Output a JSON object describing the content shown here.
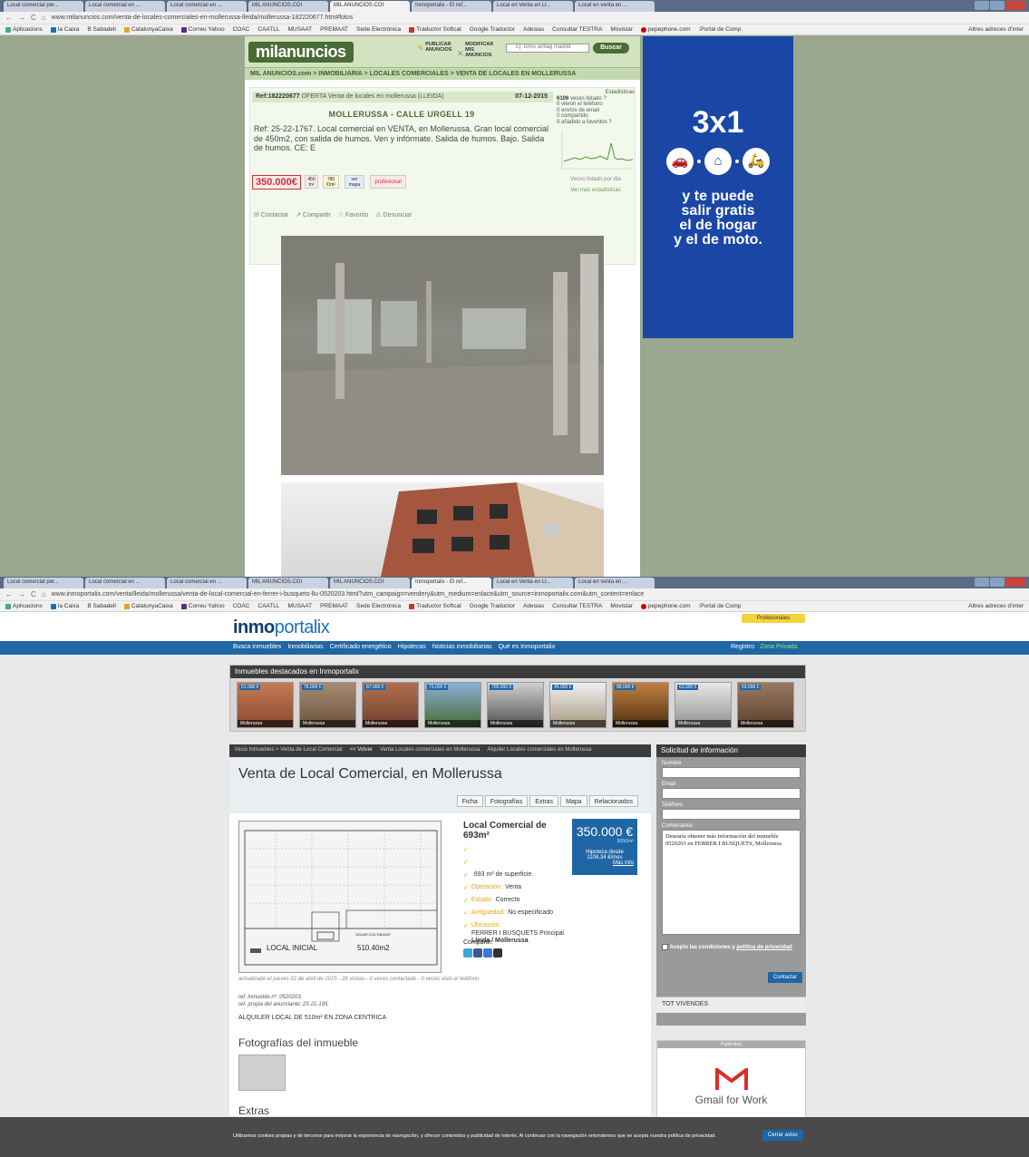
{
  "colors": {
    "mil_green": "#4b6b35",
    "mil_price_red": "#c33",
    "banner_blue": "#1a47a6",
    "inmo_blue": "#1f66a5",
    "inmo_tick": "#e5a61a"
  },
  "shot1": {
    "tabs": [
      "Local comercial per...",
      "Local comercial en ...",
      "Local comercial en ...",
      "MIL ANUNCIOS.COI",
      "MIL ANUNCIOS.COI",
      "Inmoportalix - El ref...",
      "Local en Venta en LI...",
      "Local en venta en ..."
    ],
    "url": "www.milanuncios.com/venta-de-locales-comerciales-en-mollerussa-lleida/mollerussa-182220677.htm#fotos",
    "bookmarks": [
      "Aplicacions",
      "la Caixa",
      "B Sabadell",
      "CatalunyaCaixa",
      "Correu Yahoo",
      "COAC",
      "CAATLL",
      "MUSAAT",
      "PREMAAT",
      "Sede Electrónica",
      "Traductor Softcat",
      "Google Traductor",
      "Adesias",
      "Consultar TESTRA",
      "Movistar",
      "pepephone.com",
      ":Portal de Comp"
    ],
    "bookmarks_other": "Altres adreces d'inter"
  },
  "mil": {
    "logo": "milanuncios",
    "publicar": "PUBLICAR ANUNCIOS",
    "modificar": "MODIFICAR MIS ANUNCIOS",
    "search_placeholder": "Ej: tomo airbag madrid",
    "search_button": "Buscar",
    "breadcrumb": "MIL ANUNCIOS.com > INMOBILIARIA > LOCALES COMERCIALES > VENTA DE LOCALES EN MOLLERUSSA",
    "ref": "Ref:182220677",
    "ref_tail": "OFERTA   Venta de locales en mollerussa (LLEIDA)",
    "date": "07-12-2015",
    "title": "MOLLERUSSA - CALLE URGELL 19",
    "description": "Ref: 25-22-1767. Local comercial en VENTA, en Mollerussa. Gran local comercial de 450m2, con salida de humos. Ven y infórmate. Salida de humos. Bajo. Salida de humos. CE: E",
    "price": "350.000€",
    "tag1": "450 m²",
    "tag2": "780 €/m²",
    "tag3": "ver mapa",
    "tag_prof": "profesional",
    "actions": [
      "Contactar",
      "Compartir",
      "Favorito",
      "Denunciar"
    ],
    "stats": {
      "heading": "Estadísticas",
      "views": "6106",
      "views_label": "veces listado ?",
      "lines": [
        "0 vieron el teléfono",
        "0 envíos de email",
        "0 compartido",
        "0 añadido a favoritos ?"
      ],
      "chart_label": "Veces listado por día",
      "more": "Ver más estadísticas"
    }
  },
  "banner": {
    "big": "3x1",
    "line1": "y te puede",
    "line2": "salir gratis",
    "line3": "el de hogar",
    "line4": "y el de moto."
  },
  "shot2": {
    "url": "www.inmoportalix.com/venta/lleida/mollerussa/venta-de-local-comercial-en-ferrer-i-busquets-llu-0520203.html?utm_campaign=vendery&utm_medium=enlace&utm_source=inmoportalix.com&utm_content=enlace"
  },
  "inmo": {
    "logo_a": "inmo",
    "logo_b": "portalix",
    "profesionales": "Profesionales",
    "nav": [
      "Busca inmuebles",
      "Inmobiliarias",
      "Certificado energético",
      "Hipotecas",
      "Noticias inmobiliarias",
      "Qué es Inmoportalix"
    ],
    "registro": "Registro",
    "zona_privada": "Zona Privada",
    "featured_title": "Inmuebles destacados en Inmoportalix",
    "featured": [
      {
        "price": "51.000 €",
        "loc": "Mollerussa"
      },
      {
        "price": "76.000 €",
        "loc": "Mollerussa"
      },
      {
        "price": "87.000 €",
        "loc": "Mollerussa"
      },
      {
        "price": "73.000 €",
        "loc": "Mollerussa"
      },
      {
        "price": "700.000 €",
        "loc": "Mollerussa"
      },
      {
        "price": "45.000 €",
        "loc": "Mollerussa"
      },
      {
        "price": "88.000 €",
        "loc": "Mollerussa"
      },
      {
        "price": "63.000 €",
        "loc": "Mollerussa"
      },
      {
        "price": "53.000 €",
        "loc": "Mollerussa"
      }
    ],
    "crumb": "Inicio Inmuebles > Venta de Local Comercial",
    "volver": "<< Volver",
    "crumb_links": [
      "Venta Locales comerciales en Mollerussa",
      "Alquiler Locales comerciales en Mollerussa"
    ],
    "title": "Venta de Local Comercial, en Mollerussa",
    "tabs": [
      "Ficha",
      "Fotografías",
      "Extras",
      "Mapa",
      "Relacionados"
    ],
    "plan_title": "LOCAL INICIAL",
    "plan_area": "510.40m2",
    "plan_label": "SOLAR COL·INDANT",
    "facts_head": "Local Comercial de 693m²",
    "facts": [
      {
        "label": "",
        "value": ""
      },
      {
        "label": "",
        "value": ""
      },
      {
        "label": "",
        "value": "693 m² de superficie."
      },
      {
        "label": "Operación:",
        "value": "Venta"
      },
      {
        "label": "Estado:",
        "value": "Correcto"
      },
      {
        "label": "Antigüedad:",
        "value": "No especificado"
      }
    ],
    "ubicacion_label": "Ubicación:",
    "ubicacion_street": "FERRER I BUSQUETS Principal",
    "ubicacion_city": "Lleida / Mollerussa",
    "price": "350.000 €",
    "price_m2": "505€/m²",
    "hipoteca": "Hipoteca desde",
    "hipoteca_val": "1108,34 €/mes",
    "mas_info": "Más Info",
    "share_label": "Compartir:",
    "updated": "actualizado el jueves 02 de abril de 2015 - 28 visitas - 0 veces contactado - 0 veces visto el teléfono",
    "ref1": "ref. inmueble nº: 0520203.",
    "ref2": "ref. propia del anunciante: 25-21-195.",
    "alquiler": "ALQUILER LOCAL DE 510m² EN ZONA CENTRICA",
    "fotos_h": "Fotografías del inmueble",
    "extras_h": "Extras",
    "contact_title": "Solicitud de información",
    "nombre": "Nombre",
    "email": "Email",
    "telefono": "Teléfono",
    "comentarios": "Comentarios",
    "comentario_text": "Desearía obtener más información del inmueble 0520203 en FERRER I BUSQUETS, Mollerussa",
    "accept": "Acepto las condiciones y",
    "privacidad": "política de privacidad",
    "contactar": "Contactar",
    "tot": "TOT VIVENDES",
    "publicidad": "Publicidad",
    "gmail": "Gmail for Work",
    "cookie_text": "Utilizamos cookies propias y de terceros para mejorar la experiencia de navegación, y ofrecer contenidos y publicidad de interés. Al continuar con la navegación entendemos que se acepta nuestra política de privacidad.",
    "cookie_btn": "Cerrar aviso"
  }
}
